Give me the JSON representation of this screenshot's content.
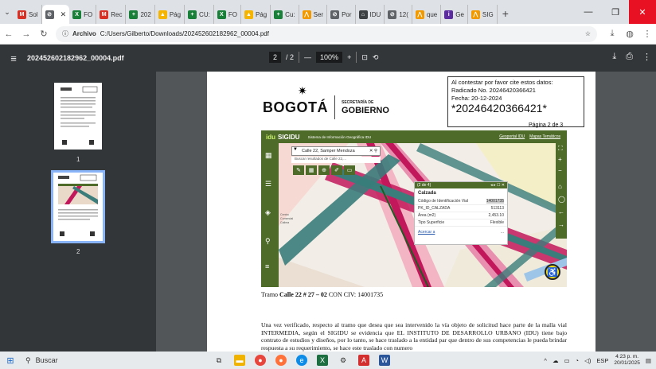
{
  "tabs": [
    {
      "label": "Sol",
      "icon": "gmail-icon",
      "color": "#d93025",
      "glyph": "M"
    },
    {
      "label": "",
      "icon": "chrome-pdf-icon",
      "color": "#5f6368",
      "glyph": "⊘",
      "active": true
    },
    {
      "label": "FO",
      "icon": "sheets-icon",
      "color": "#188038",
      "glyph": "X"
    },
    {
      "label": "Rec",
      "icon": "gmail-icon",
      "color": "#d93025",
      "glyph": "M"
    },
    {
      "label": "202",
      "icon": "sheets-icon",
      "color": "#188038",
      "glyph": "+"
    },
    {
      "label": "Pág",
      "icon": "drive-icon",
      "color": "#f4b400",
      "glyph": "▲"
    },
    {
      "label": "CU:",
      "icon": "sheets-icon",
      "color": "#188038",
      "glyph": "+"
    },
    {
      "label": "FO",
      "icon": "excel-icon",
      "color": "#188038",
      "glyph": "X"
    },
    {
      "label": "Pág",
      "icon": "drive-icon",
      "color": "#f4b400",
      "glyph": "▲"
    },
    {
      "label": "Cu:",
      "icon": "sheets-icon",
      "color": "#188038",
      "glyph": "+"
    },
    {
      "label": "Ser",
      "icon": "bogota-icon",
      "color": "#f29900",
      "glyph": "⋀"
    },
    {
      "label": "Por",
      "icon": "chrome-icon",
      "color": "#5f6368",
      "glyph": "⊘"
    },
    {
      "label": "IDU",
      "icon": "idu-icon",
      "color": "#3c4043",
      "glyph": "⌂"
    },
    {
      "label": "12(",
      "icon": "chrome-icon",
      "color": "#5f6368",
      "glyph": "⊘"
    },
    {
      "label": "que",
      "icon": "bogota-icon",
      "color": "#f29900",
      "glyph": "⋀"
    },
    {
      "label": "Ge",
      "icon": "idu-icon",
      "color": "#5b2ca0",
      "glyph": "i"
    },
    {
      "label": "SIG",
      "icon": "bogota-icon",
      "color": "#f29900",
      "glyph": "⋀"
    }
  ],
  "address": {
    "chip": "Archivo",
    "url": "C:/Users/Gilberto/Downloads/202452602182962_00004.pdf"
  },
  "pdf": {
    "title": "202452602182962_00004.pdf",
    "page_current": "2",
    "page_total": "/ 2",
    "zoom": "100%",
    "thumb1": "1",
    "thumb2": "2"
  },
  "doc": {
    "bogota": "BOGOTÁ",
    "secretaria": "SECRETARÍA DE",
    "gobierno": "GOBIERNO",
    "rad_line1": "Al contestar por favor cite estos datos:",
    "rad_line2": "Radicado No. 20246420366421",
    "rad_line3": "Fecha: 20-12-2024",
    "rad_big": "*20246420366421*",
    "pagina": "Página 2 de 3",
    "caption_prefix": "Tramo ",
    "caption_bold": "Calle 22 # 27 – 02",
    "caption_suffix": "  CON CIV: 14001735",
    "body": "Una vez verificado, respecto al tramo que desea que sea intervenido la vía objeto de solicitud hace parte de la malla vial INTERMEDIA, según el SIGIDU se evidencia que EL INSTITUTO DE DESARROLLO URBANO (IDU) tiene bajo contrato de estudios y diseños, por lo tanto, se hace traslado a la entidad par que dentro de sus competencias le pueda brindar respuesta a su requerimiento, se hace este traslado con numero"
  },
  "map": {
    "brand": "idu",
    "name": "SIGIDU",
    "subtitle": "Sistema de Información Geográfica IDU",
    "link1": "Geoportal IDU",
    "link2": "Mapas Temáticos",
    "search_value": "Calle 22, Samper Mendoza",
    "search_hint": "Buscar resultados de Calle 22,...",
    "place_label": "Centro Comercial Calima",
    "popup_counter": "(2 de 4)",
    "popup_title": "Calzada",
    "rows": [
      {
        "k": "Código de Identificación Vial",
        "v": "14001735"
      },
      {
        "k": "PK_ID_CALZADA",
        "v": "513113"
      },
      {
        "k": "Área (m2)",
        "v": "2,453.10"
      },
      {
        "k": "Tipo Superficie",
        "v": "Flexible"
      }
    ],
    "popup_link": "Acercar a",
    "popup_more": "..."
  },
  "taskbar": {
    "search": "Buscar",
    "lang": "ESP",
    "time": "4:23 p. m.",
    "date": "20/01/2025"
  }
}
